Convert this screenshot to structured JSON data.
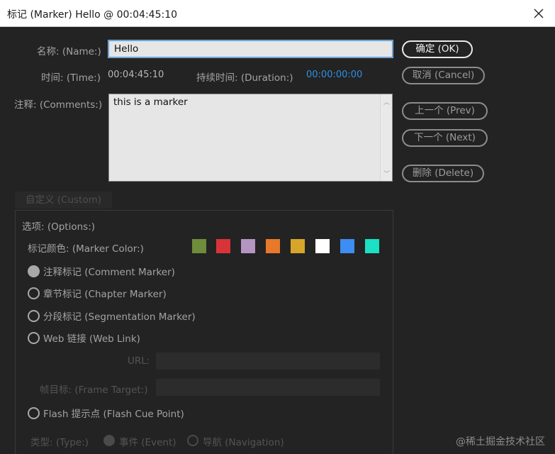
{
  "window": {
    "title": "标记 (Marker) Hello @ 00:04:45:10"
  },
  "fields": {
    "name_label": "名称: (Name:)",
    "name_value": "Hello",
    "time_label": "时间: (Time:)",
    "time_value": "00:04:45:10",
    "duration_label": "持续时间: (Duration:)",
    "duration_value": "00:00:00:00",
    "comments_label": "注释: (Comments:)",
    "comments_value": "this is a marker"
  },
  "buttons": {
    "ok": "确定 (OK)",
    "cancel": "取消 (Cancel)",
    "prev": "上一个 (Prev)",
    "next": "下一个 (Next)",
    "delete": "删除 (Delete)",
    "custom": "自定义 (Custom)"
  },
  "options": {
    "title": "选项: (Options:)",
    "marker_color_label": "标记颜色: (Marker Color:)",
    "marker_colors": [
      "#6f8c3a",
      "#d9333a",
      "#b395c0",
      "#e8782a",
      "#d6a62a",
      "#ffffff",
      "#3d8df2",
      "#1ae0c4"
    ],
    "marker_types": [
      {
        "label": "注释标记 (Comment Marker)",
        "selected": true
      },
      {
        "label": "章节标记 (Chapter Marker)",
        "selected": false
      },
      {
        "label": "分段标记 (Segmentation Marker)",
        "selected": false
      },
      {
        "label": "Web 链接 (Web Link)",
        "selected": false
      },
      {
        "label": "Flash 提示点 (Flash Cue Point)",
        "selected": false
      }
    ],
    "url_label": "URL:",
    "frame_target_label": "帧目标: (Frame Target:)",
    "type_label": "类型: (Type:)",
    "type_event": "事件 (Event)",
    "type_navigation": "导航 (Navigation)"
  },
  "watermark": "@稀土掘金技术社区"
}
